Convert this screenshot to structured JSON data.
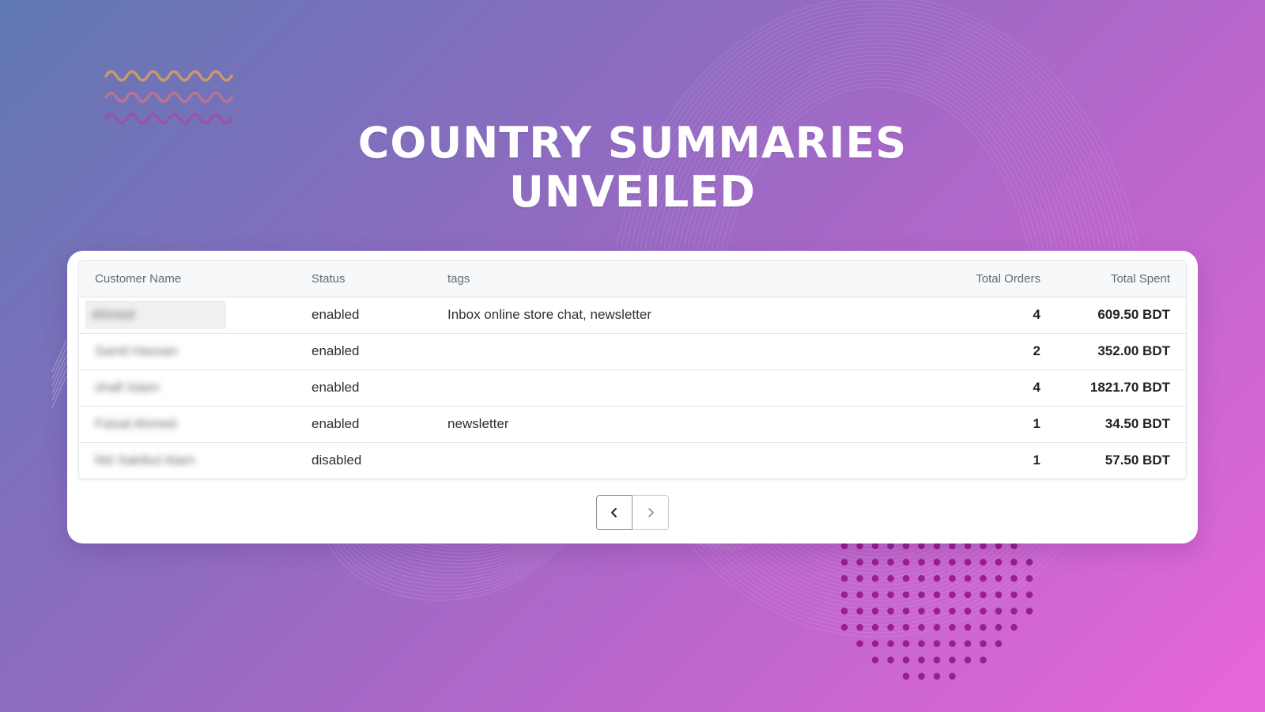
{
  "title": {
    "line1": "COUNTRY SUMMARIES",
    "line2": "UNVEILED"
  },
  "table": {
    "columns": [
      "Customer Name",
      "Status",
      "tags",
      "Total Orders",
      "Total Spent"
    ],
    "rows": [
      {
        "name": "Ahmed",
        "status": "enabled",
        "tags": "Inbox online store chat, newsletter",
        "orders": "4",
        "spent": "609.50 BDT"
      },
      {
        "name": "Samil Hassan",
        "status": "enabled",
        "tags": "",
        "orders": "2",
        "spent": "352.00 BDT"
      },
      {
        "name": "shafi Islam",
        "status": "enabled",
        "tags": "",
        "orders": "4",
        "spent": "1821.70 BDT"
      },
      {
        "name": "Faisal Ahmed",
        "status": "enabled",
        "tags": "newsletter",
        "orders": "1",
        "spent": "34.50 BDT"
      },
      {
        "name": "Md Sakibul Alam",
        "status": "disabled",
        "tags": "",
        "orders": "1",
        "spent": "57.50 BDT"
      }
    ]
  },
  "pagination": {
    "prev_icon": "chevron-left-icon",
    "next_icon": "chevron-right-icon"
  },
  "colors": {
    "gradient_start": "#5f78b2",
    "gradient_end": "#e866dc",
    "wave_colors": [
      "#c99a6a",
      "#b77493",
      "#9b52a7"
    ],
    "dot_color": "#9a1f86"
  }
}
